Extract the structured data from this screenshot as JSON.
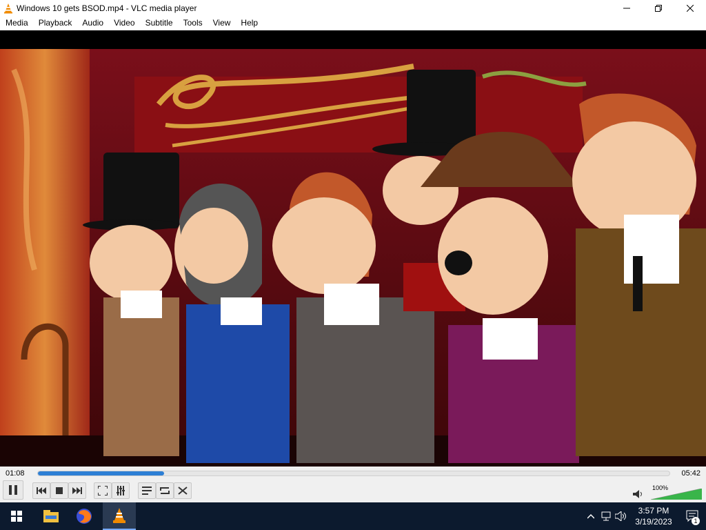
{
  "window": {
    "title": "Windows 10 gets BSOD.mp4 - VLC media player",
    "icon": "vlc-cone-icon"
  },
  "menu": [
    {
      "label": "Media"
    },
    {
      "label": "Playback"
    },
    {
      "label": "Audio"
    },
    {
      "label": "Video"
    },
    {
      "label": "Subtitle"
    },
    {
      "label": "Tools"
    },
    {
      "label": "View"
    },
    {
      "label": "Help"
    }
  ],
  "player": {
    "elapsed": "01:08",
    "total": "05:42",
    "progress": 0.2,
    "volume_label": "100%",
    "volume": 1.0
  },
  "controls": {
    "pause_icon": "pause-icon",
    "prev_icon": "previous-icon",
    "stop_icon": "stop-icon",
    "next_icon": "next-icon",
    "fullscreen_icon": "fullscreen-icon",
    "extended_icon": "extended-settings-icon",
    "playlist_icon": "playlist-icon",
    "loop_icon": "loop-icon",
    "shuffle_icon": "shuffle-icon"
  },
  "taskbar": {
    "time": "3:57 PM",
    "date": "3/19/2023",
    "notification_count": "1"
  },
  "colors": {
    "accent": "#2d7fd5",
    "taskbar": "#0c1a2e",
    "volume": "#39b54a"
  }
}
